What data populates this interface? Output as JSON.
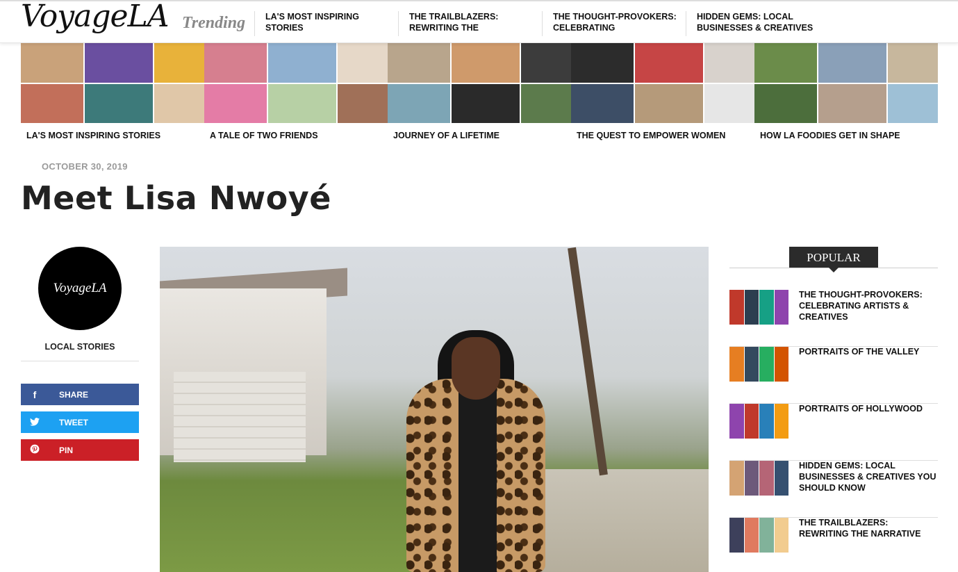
{
  "site": {
    "logo": "VoyageLA",
    "trending_label": "Trending"
  },
  "trending_links": [
    {
      "label": "LA'S MOST INSPIRING STORIES"
    },
    {
      "label": "THE TRAILBLAZERS: REWRITING THE"
    },
    {
      "label": "THE THOUGHT-PROVOKERS: CELEBRATING"
    },
    {
      "label": "HIDDEN GEMS: LOCAL BUSINESSES & CREATIVES"
    }
  ],
  "features": [
    {
      "title": "LA'S MOST INSPIRING STORIES",
      "colors": [
        "#c9a27a",
        "#6a4fa0",
        "#e8b23a",
        "#c26f5a",
        "#3d7a7a",
        "#e0c7a8"
      ]
    },
    {
      "title": "A TALE OF TWO FRIENDS",
      "colors": [
        "#d67f8f",
        "#8fb0d0",
        "#e6d8c8",
        "#e47ca6",
        "#b7d0a5",
        "#a07058"
      ]
    },
    {
      "title": "JOURNEY OF A LIFETIME",
      "colors": [
        "#b8a58c",
        "#cf9a6b",
        "#3c3c3c",
        "#7da5b5",
        "#2a2a2a",
        "#5c7b4c"
      ]
    },
    {
      "title": "THE QUEST TO EMPOWER WOMEN",
      "colors": [
        "#2c2c2c",
        "#c64545",
        "#d8d2cc",
        "#3d4e66",
        "#b59a7a",
        "#e6e6e6"
      ]
    },
    {
      "title": "HOW LA FOODIES GET IN SHAPE",
      "colors": [
        "#6b8c4a",
        "#8aa0b8",
        "#c7b79d",
        "#4c6e3c",
        "#b59f8d",
        "#9ec0d6"
      ]
    }
  ],
  "article": {
    "date": "OCTOBER 30, 2019",
    "title": "Meet Lisa Nwoyé",
    "category": "LOCAL STORIES",
    "avatar_text": "VoyageLA"
  },
  "share": {
    "facebook": {
      "label": "SHARE",
      "icon": "facebook-icon",
      "color": "#3b5998"
    },
    "twitter": {
      "label": "TWEET",
      "icon": "twitter-icon",
      "color": "#1da1f2"
    },
    "pinterest": {
      "label": "PIN",
      "icon": "pinterest-icon",
      "color": "#cb2027"
    }
  },
  "popular": {
    "heading": "POPULAR",
    "items": [
      {
        "title": "THE THOUGHT-PROVOKERS: CELEBRATING ARTISTS & CREATIVES",
        "colors": [
          "#c0392b",
          "#2c3e50",
          "#16a085",
          "#8e44ad"
        ]
      },
      {
        "title": "PORTRAITS OF THE VALLEY",
        "colors": [
          "#e67e22",
          "#34495e",
          "#27ae60",
          "#d35400"
        ]
      },
      {
        "title": "PORTRAITS OF HOLLYWOOD",
        "colors": [
          "#8e44ad",
          "#c0392b",
          "#2980b9",
          "#f39c12"
        ]
      },
      {
        "title": "HIDDEN GEMS: LOCAL BUSINESSES & CREATIVES YOU SHOULD KNOW",
        "colors": [
          "#d4a373",
          "#6d597a",
          "#b56576",
          "#355070"
        ]
      },
      {
        "title": "THE TRAILBLAZERS: REWRITING THE NARRATIVE",
        "colors": [
          "#3d405b",
          "#e07a5f",
          "#81b29a",
          "#f2cc8f"
        ]
      }
    ]
  }
}
